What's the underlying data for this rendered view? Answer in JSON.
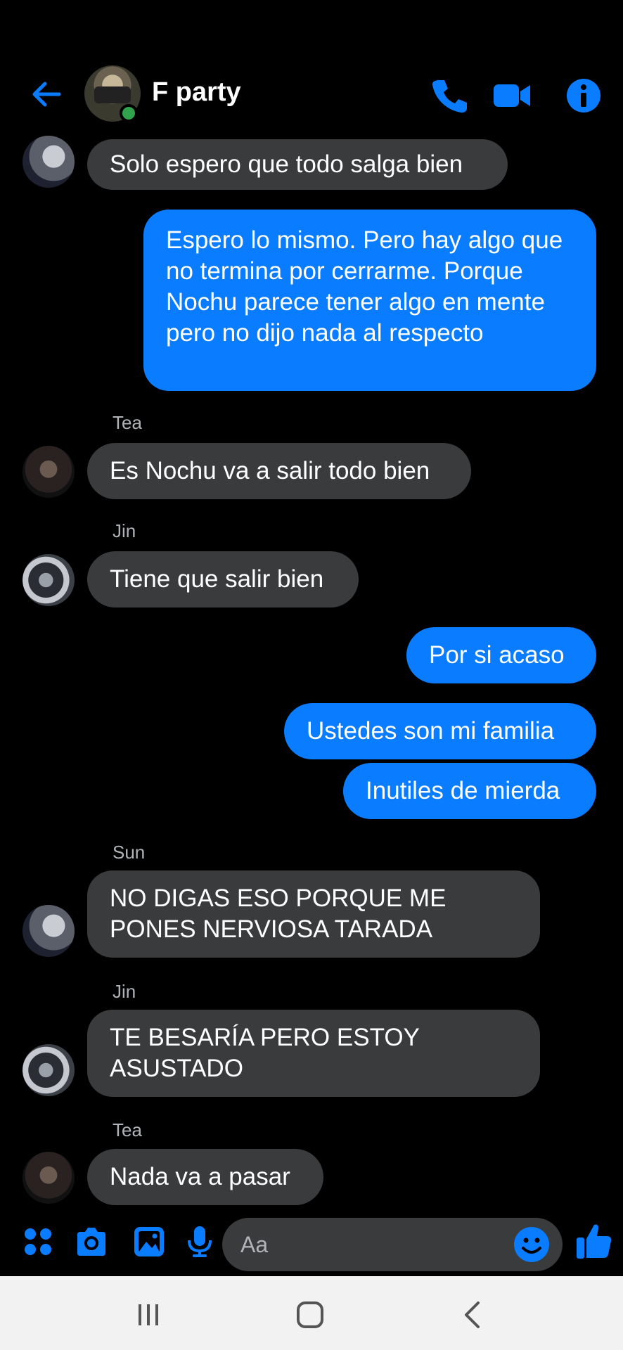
{
  "header": {
    "title": "F party",
    "online": true
  },
  "composer": {
    "placeholder": "Aa"
  },
  "messages": [
    {
      "sender": "",
      "text": "Solo espero que todo salga bien",
      "direction": "received"
    },
    {
      "sender": "",
      "text": "Espero lo mismo. Pero hay algo que no termina por cerrarme. Porque Nochu parece tener algo en mente pero no dijo nada al respecto",
      "direction": "sent"
    },
    {
      "sender": "Tea",
      "text": "Es Nochu va a salir todo bien",
      "direction": "received"
    },
    {
      "sender": "Jin",
      "text": "Tiene que salir bien",
      "direction": "received"
    },
    {
      "sender": "",
      "text": "Por si acaso",
      "direction": "sent"
    },
    {
      "sender": "",
      "text": "Ustedes son mi familia",
      "direction": "sent"
    },
    {
      "sender": "",
      "text": "Inutiles de mierda",
      "direction": "sent"
    },
    {
      "sender": "Sun",
      "text": "NO DIGAS ESO PORQUE ME PONES NERVIOSA TARADA",
      "direction": "received"
    },
    {
      "sender": "Jin",
      "text": "TE BESARÍA PERO ESTOY ASUSTADO",
      "direction": "received"
    },
    {
      "sender": "Tea",
      "text": "Nada va a pasar",
      "direction": "received"
    }
  ],
  "colors": {
    "accent": "#0a7cff",
    "received_bubble": "#3a3b3c",
    "background": "#000000",
    "online": "#31a24c"
  },
  "icons": [
    "back-arrow-icon",
    "phone-icon",
    "video-camera-icon",
    "info-icon",
    "menu-dots-icon",
    "camera-icon",
    "image-icon",
    "microphone-icon",
    "emoji-icon",
    "thumbs-up-icon",
    "recent-apps-icon",
    "home-icon",
    "nav-back-icon"
  ]
}
